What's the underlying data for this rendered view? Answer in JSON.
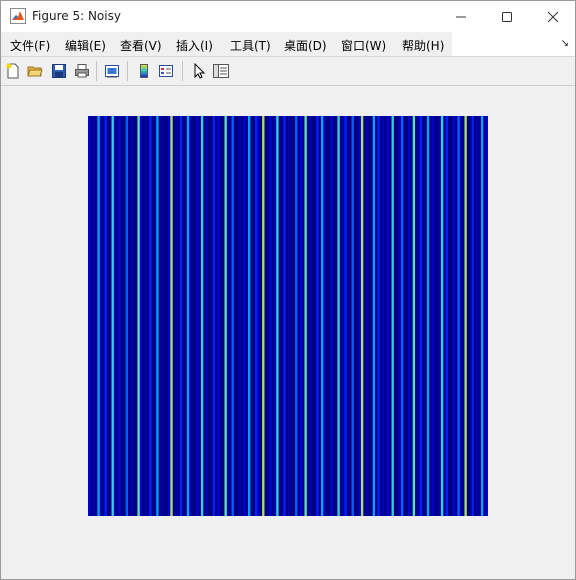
{
  "window": {
    "title": "Figure 5: Noisy"
  },
  "menubar": {
    "items": [
      {
        "label": "文件(F)"
      },
      {
        "label": "编辑(E)"
      },
      {
        "label": "查看(V)"
      },
      {
        "label": "插入(I)"
      },
      {
        "label": "工具(T)"
      },
      {
        "label": "桌面(D)"
      },
      {
        "label": "窗口(W)"
      },
      {
        "label": "帮助(H)"
      }
    ]
  },
  "toolbar": {
    "buttons": [
      {
        "icon": "new-figure-icon"
      },
      {
        "icon": "open-file-icon"
      },
      {
        "icon": "save-icon"
      },
      {
        "icon": "print-icon"
      },
      {
        "icon": "link-plot-icon"
      },
      {
        "icon": "insert-colorbar-icon"
      },
      {
        "icon": "insert-legend-icon"
      },
      {
        "icon": "edit-plot-pointer-icon"
      },
      {
        "icon": "property-inspector-icon"
      }
    ]
  },
  "colors": {
    "background": "#f0f0f0",
    "image_base": "#00008f",
    "stripe_palette": [
      "#000080",
      "#0000b0",
      "#0000d8",
      "#0020ff",
      "#0060ff",
      "#00a0ff",
      "#30d0e0",
      "#60e0b0",
      "#b0e060"
    ]
  },
  "chart_data": {
    "type": "heatmap",
    "colormap": "parula",
    "description_visible": "vertical noisy stripes; each column constant down the rows",
    "column_levels": [
      2,
      0,
      1,
      0,
      5,
      1,
      0,
      3,
      0,
      0,
      6,
      1,
      0,
      2,
      0,
      0,
      4,
      0,
      1,
      0,
      0,
      7,
      2,
      0,
      1,
      0,
      3,
      0,
      0,
      5,
      0,
      1,
      0,
      0,
      2,
      8,
      0,
      1,
      0,
      3,
      0,
      0,
      5,
      1,
      0,
      0,
      2,
      0,
      6,
      0,
      1,
      0,
      0,
      3,
      0,
      2,
      0,
      0,
      7,
      1,
      0,
      4,
      0,
      0,
      1,
      0,
      2,
      0,
      5,
      0,
      0,
      3,
      1,
      0,
      8,
      0,
      0,
      2,
      0,
      1,
      6,
      0,
      0,
      3,
      0,
      1,
      0,
      0,
      4,
      0,
      2,
      0,
      7,
      0,
      1,
      0,
      0,
      3,
      0,
      5,
      1,
      0,
      0,
      2,
      0,
      0,
      6,
      0,
      1,
      3,
      0,
      0,
      4,
      0,
      0,
      2,
      8,
      0,
      1,
      0,
      0,
      5,
      0,
      3,
      0,
      1,
      0,
      2,
      0,
      6,
      0,
      0,
      1,
      4,
      0,
      0,
      2,
      0,
      7,
      0,
      1,
      3,
      0,
      0,
      5,
      0,
      2,
      0,
      0,
      1,
      6,
      0,
      3,
      0,
      0,
      2,
      0,
      4,
      1,
      0,
      8,
      0,
      0,
      3,
      0,
      1,
      0,
      5,
      0,
      2
    ]
  }
}
